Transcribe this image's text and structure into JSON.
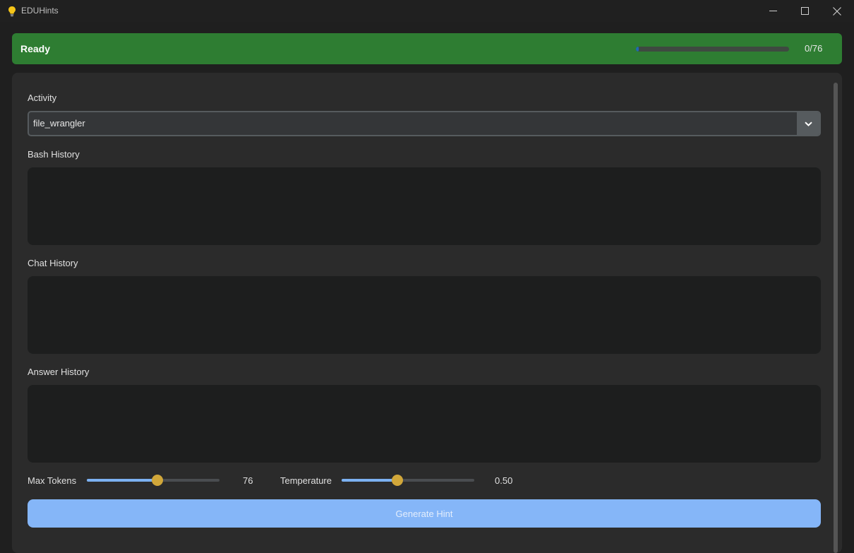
{
  "window": {
    "title": "EDUHints",
    "icons": {
      "app": "lightbulb-icon",
      "minimize": "minimize-icon",
      "maximize": "maximize-icon",
      "close": "close-icon"
    }
  },
  "status": {
    "text": "Ready",
    "progress_fraction": 0.02,
    "progress_text": "0/76",
    "color": "#2e7d32"
  },
  "form": {
    "activity": {
      "label": "Activity",
      "value": "file_wrangler",
      "icon": "chevron-down-icon"
    },
    "bash_history": {
      "label": "Bash History",
      "value": ""
    },
    "chat_history": {
      "label": "Chat History",
      "value": ""
    },
    "answer_history": {
      "label": "Answer History",
      "value": ""
    },
    "max_tokens": {
      "label": "Max Tokens",
      "value_text": "76",
      "fraction": 0.53
    },
    "temperature": {
      "label": "Temperature",
      "value_text": "0.50",
      "fraction": 0.42
    },
    "generate_label": "Generate Hint"
  },
  "colors": {
    "accent": "#85b6f8",
    "knob": "#d1a73a",
    "slider_fill": "#7cb1f2"
  }
}
